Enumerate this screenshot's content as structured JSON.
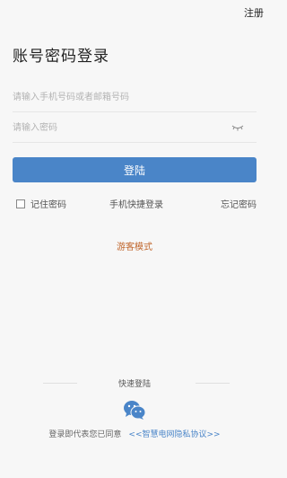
{
  "header": {
    "register_label": "注册"
  },
  "page_title": "账号密码登录",
  "form": {
    "account_placeholder": "请输入手机号码或者邮箱号码",
    "account_value": "",
    "password_placeholder": "请输入密码",
    "password_value": "",
    "login_label": "登陆",
    "remember_label": "记住密码",
    "phone_quick_login_label": "手机快捷登录",
    "forgot_label": "忘记密码"
  },
  "guest_mode_label": "游客模式",
  "quick_login": {
    "label": "快速登陆"
  },
  "agreement": {
    "text": "登录即代表您已同意",
    "link": "<<智慧电网隐私协议>>"
  },
  "colors": {
    "accent": "#4a85c8",
    "guest": "#c0662c",
    "wechat": "#4a85c8"
  },
  "icons": {
    "eye": "eye-closed-icon",
    "wechat": "wechat-icon"
  }
}
